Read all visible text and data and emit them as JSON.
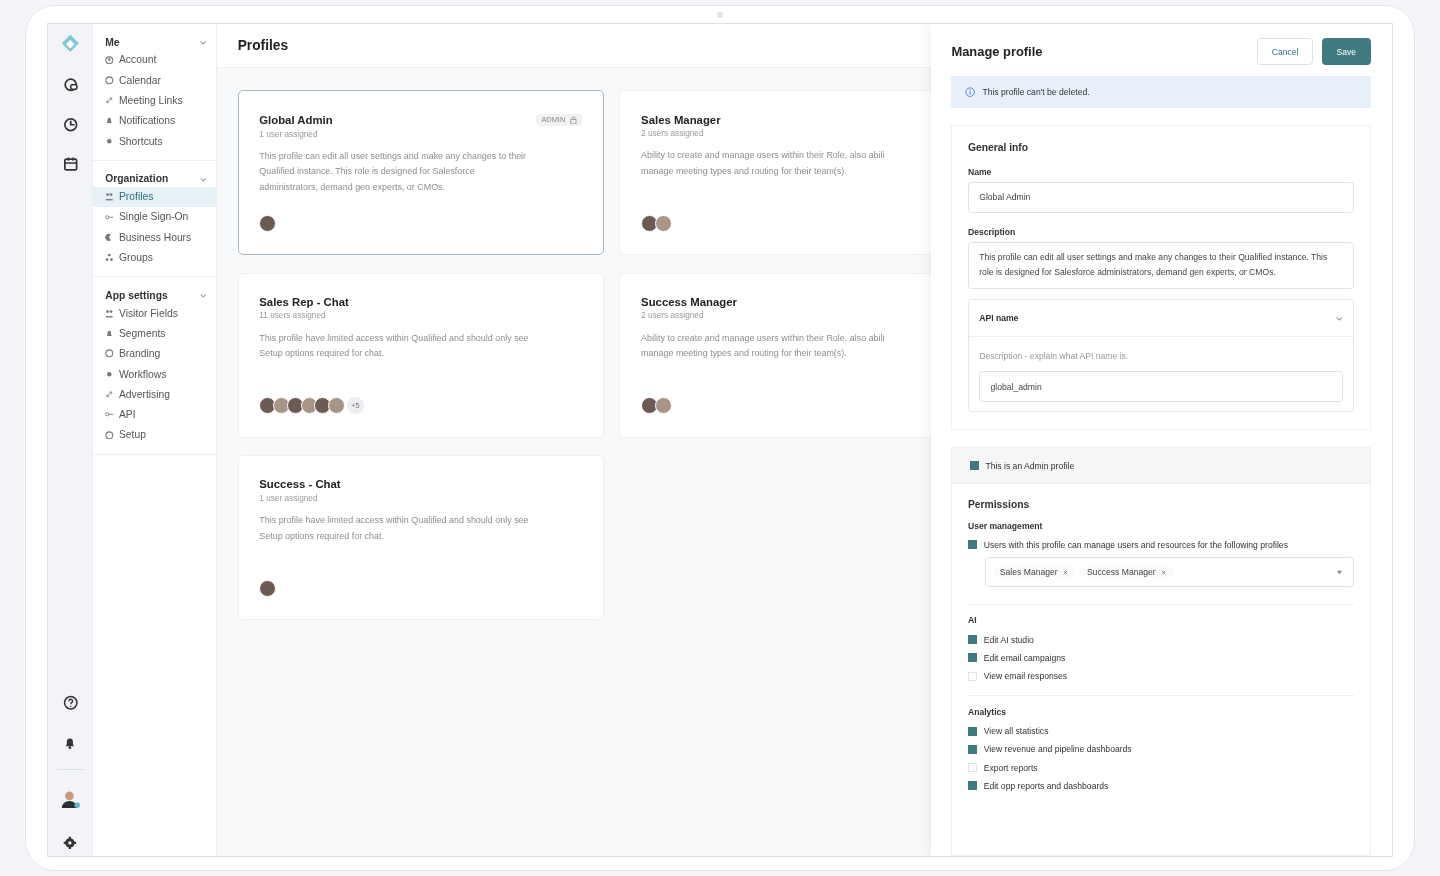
{
  "nav": {
    "groups": [
      {
        "title": "Me",
        "expanded": true,
        "items": [
          {
            "label": "Account",
            "selected": false
          },
          {
            "label": "Calendar",
            "selected": false
          },
          {
            "label": "Meeting Links",
            "selected": false
          },
          {
            "label": "Notifications",
            "selected": false
          },
          {
            "label": "Shortcuts",
            "selected": false
          }
        ]
      },
      {
        "title": "Organization",
        "expanded": true,
        "items": [
          {
            "label": "Profiles",
            "selected": true
          },
          {
            "label": "Single Sign-On",
            "selected": false
          },
          {
            "label": "Business Hours",
            "selected": false
          },
          {
            "label": "Groups",
            "selected": false
          }
        ]
      },
      {
        "title": "App settings",
        "expanded": true,
        "items": [
          {
            "label": "Visitor Fields",
            "selected": false
          },
          {
            "label": "Segments",
            "selected": false
          },
          {
            "label": "Branding",
            "selected": false
          },
          {
            "label": "Workflows",
            "selected": false
          },
          {
            "label": "Advertising",
            "selected": false
          },
          {
            "label": "API",
            "selected": false
          },
          {
            "label": "Setup",
            "selected": false
          }
        ]
      }
    ]
  },
  "main": {
    "title": "Profiles",
    "cards": [
      {
        "title": "Global Admin",
        "subtitle": "1 user assigned",
        "badge": "ADMIN",
        "selected": true,
        "lines": [
          "This profile can edit all user settings and make any changes to their",
          "Qualified instance. This role is designed for Salesforce",
          "administrators, demand gen experts, or CMOs."
        ],
        "avatars": [
          {
            "kind": "photo"
          }
        ]
      },
      {
        "title": "Sales Manager",
        "subtitle": "2 users assigned",
        "selected": false,
        "lines": [
          "Ability to create and manage users within their Role, also abili",
          "manage meeting types and routing for their team(s)."
        ],
        "avatars": [
          {
            "kind": "photo"
          },
          {
            "kind": "photo"
          }
        ]
      },
      {
        "title": "Sales Rep - Chat",
        "subtitle": "11 users assigned",
        "selected": false,
        "lines": [
          "This profile have limited access within Qualified and should only see",
          "Setup options required for chat."
        ],
        "avatars": [
          {
            "kind": "photo"
          },
          {
            "kind": "photo"
          },
          {
            "kind": "photo"
          },
          {
            "kind": "photo"
          },
          {
            "kind": "photo"
          },
          {
            "kind": "photo"
          }
        ],
        "more": "+5"
      },
      {
        "title": "Success Manager",
        "subtitle": "2 users assigned",
        "selected": false,
        "lines": [
          "Ability to create and manage users within their Role, also abili",
          "manage meeting types and routing for their team(s)."
        ],
        "avatars": [
          {
            "kind": "photo"
          },
          {
            "kind": "photo"
          }
        ]
      },
      {
        "title": "Success - Chat",
        "subtitle": "1 user assigned",
        "selected": false,
        "lines": [
          "This profile have limited access within Qualified and should only see",
          "Setup options required for chat."
        ],
        "avatars": [
          {
            "kind": "photo"
          }
        ]
      }
    ]
  },
  "panel": {
    "title": "Manage profile",
    "buttons": [
      {
        "label": "Cancel",
        "kind": "secondary"
      },
      {
        "label": "Save",
        "kind": "primary"
      }
    ],
    "notice": "This profile can't be deleted.",
    "general": {
      "title": "General info",
      "name_label": "Name",
      "name_value": "Global Admin",
      "description_label": "Description",
      "description_value": "This profile can edit all user settings and make any changes to their Qualified instance. This role is designed for Salesforce administrators, demand gen experts, or CMOs.",
      "api": {
        "label": "API name",
        "expanded": true,
        "hint": "Description - explain what API name is.",
        "value": "global_admin"
      }
    },
    "admin": {
      "label": "This is an Admin profile",
      "checked": true
    },
    "permissions": {
      "title": "Permissions",
      "sections": [
        {
          "title": "User management",
          "items": [
            {
              "label": "Users with this profile can manage users and resources for the following profiles",
              "checked": true
            }
          ],
          "tags": [
            "Sales Manager",
            "Success Manager"
          ]
        },
        {
          "title": "AI",
          "items": [
            {
              "label": "Edit AI studio",
              "checked": true
            },
            {
              "label": "Edit email campaigns",
              "checked": true
            },
            {
              "label": "View email responses",
              "checked": false
            }
          ]
        },
        {
          "title": "Analytics",
          "items": [
            {
              "label": "View all statistics",
              "checked": true
            },
            {
              "label": "View revenue and pipeline dashboards",
              "checked": true
            },
            {
              "label": "Export reports",
              "checked": false
            },
            {
              "label": "Edit opp reports and dashboards",
              "checked": true
            }
          ]
        }
      ]
    }
  }
}
